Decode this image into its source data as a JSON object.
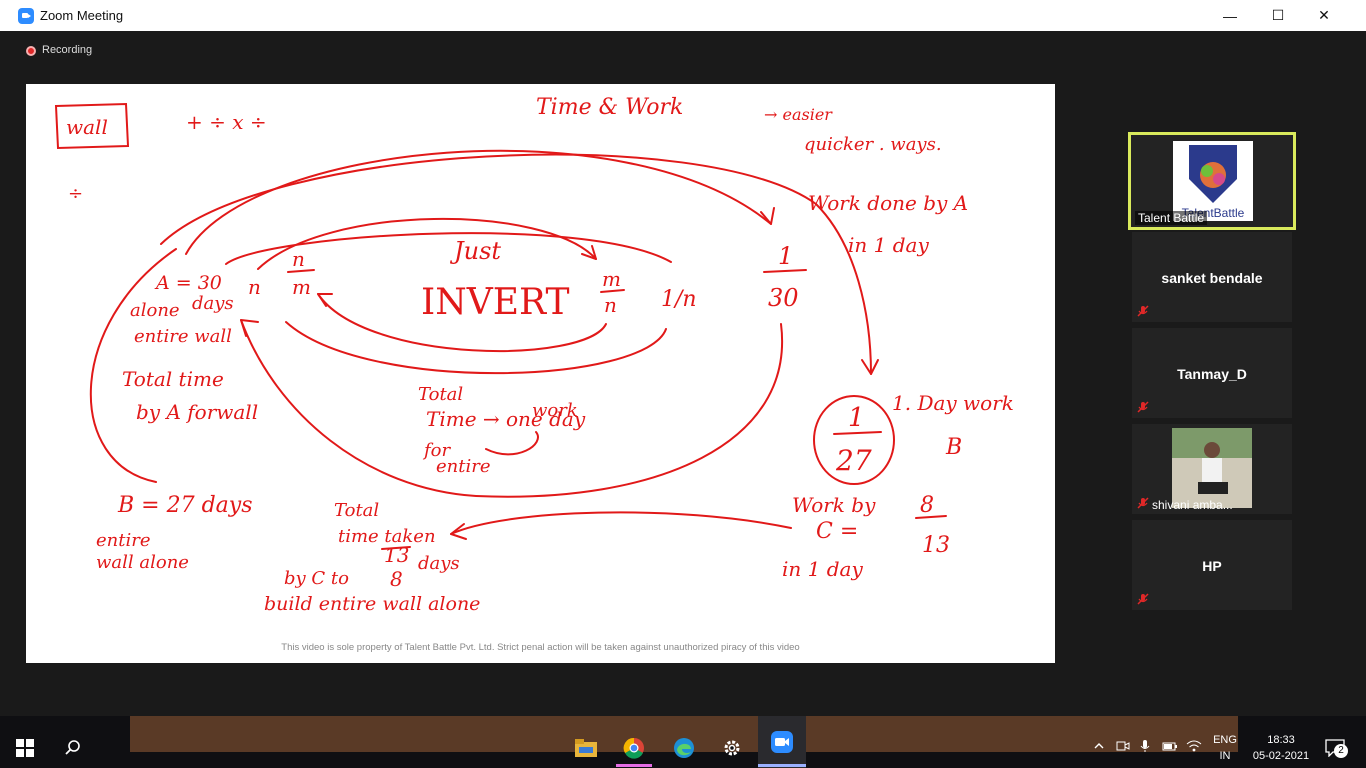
{
  "window": {
    "title": "Zoom Meeting",
    "minimize_glyph": "—",
    "maximize_glyph": "☐",
    "close_glyph": "✕"
  },
  "recording": {
    "label": "Recording"
  },
  "share": {
    "footer": "This video is sole property of Talent Battle Pvt. Ltd. Strict penal action will be taken against unauthorized piracy of this video",
    "handwriting": {
      "wall": "wall",
      "ops": "+ ÷ x ÷",
      "divide": "÷",
      "title": "Time & Work",
      "easier": "→ easier",
      "quicker": "quicker . ways.",
      "work_done_by_a": "Work done by A",
      "in_1_day": "in 1 day",
      "a_eq": "A = 30",
      "days": "days",
      "alone": "alone",
      "entire_wall": "entire wall",
      "n_left": "n",
      "n_over": "n",
      "m_under": "m",
      "just": "Just",
      "invert": "INVERT",
      "m_over": "m",
      "n_under": "n",
      "one_over_n": "1/n",
      "one_top": "1",
      "thirty_bottom": "30",
      "total_time": "Total time",
      "by_a_for_wall": "by A forwall",
      "total_time_2": "Total",
      "time_arrow": "Time → one day",
      "work": "work",
      "for": "for",
      "entire": "entire",
      "one_day_work": "1. Day work",
      "b_label": "B",
      "one_top_2": "1",
      "twenty_seven": "27",
      "b_eq": "B  = 27 days",
      "entire_2": "entire",
      "wall_alone": "wall alone",
      "total_2": "Total",
      "time_taken": "time taken",
      "thirteen": "13",
      "eight": "8",
      "days_2": "days",
      "by_c_to": "by C to",
      "build_entire": "build entire wall alone",
      "work_by": "Work by",
      "c_eq": "C =",
      "in_1_day_2": "in 1 day",
      "eight_top": "8",
      "thirteen_bottom": "13"
    }
  },
  "participants": [
    {
      "name": "Talent Battle",
      "type": "logo",
      "logo_text": "TalentBattle",
      "active": true
    },
    {
      "name": "sanket bendale",
      "type": "name",
      "muted": true
    },
    {
      "name": "Tanmay_D",
      "type": "name",
      "muted": true
    },
    {
      "name": "shivani amba...",
      "type": "photo",
      "muted": true
    },
    {
      "name": "HP",
      "type": "name",
      "muted": true
    }
  ],
  "taskbar": {
    "icons": [
      "windows-start-icon",
      "search-icon",
      "file-explorer-icon",
      "chrome-icon",
      "edge-icon",
      "settings-icon",
      "zoom-icon"
    ],
    "tray": {
      "language_line1": "ENG",
      "language_line2": "IN",
      "time": "18:33",
      "date": "05-02-2021",
      "notifications": "2"
    }
  },
  "colors": {
    "ink": "#e11919",
    "active_border": "#d9ea5c",
    "tile_bg": "#232323",
    "zoom_blue": "#2d8cff"
  }
}
